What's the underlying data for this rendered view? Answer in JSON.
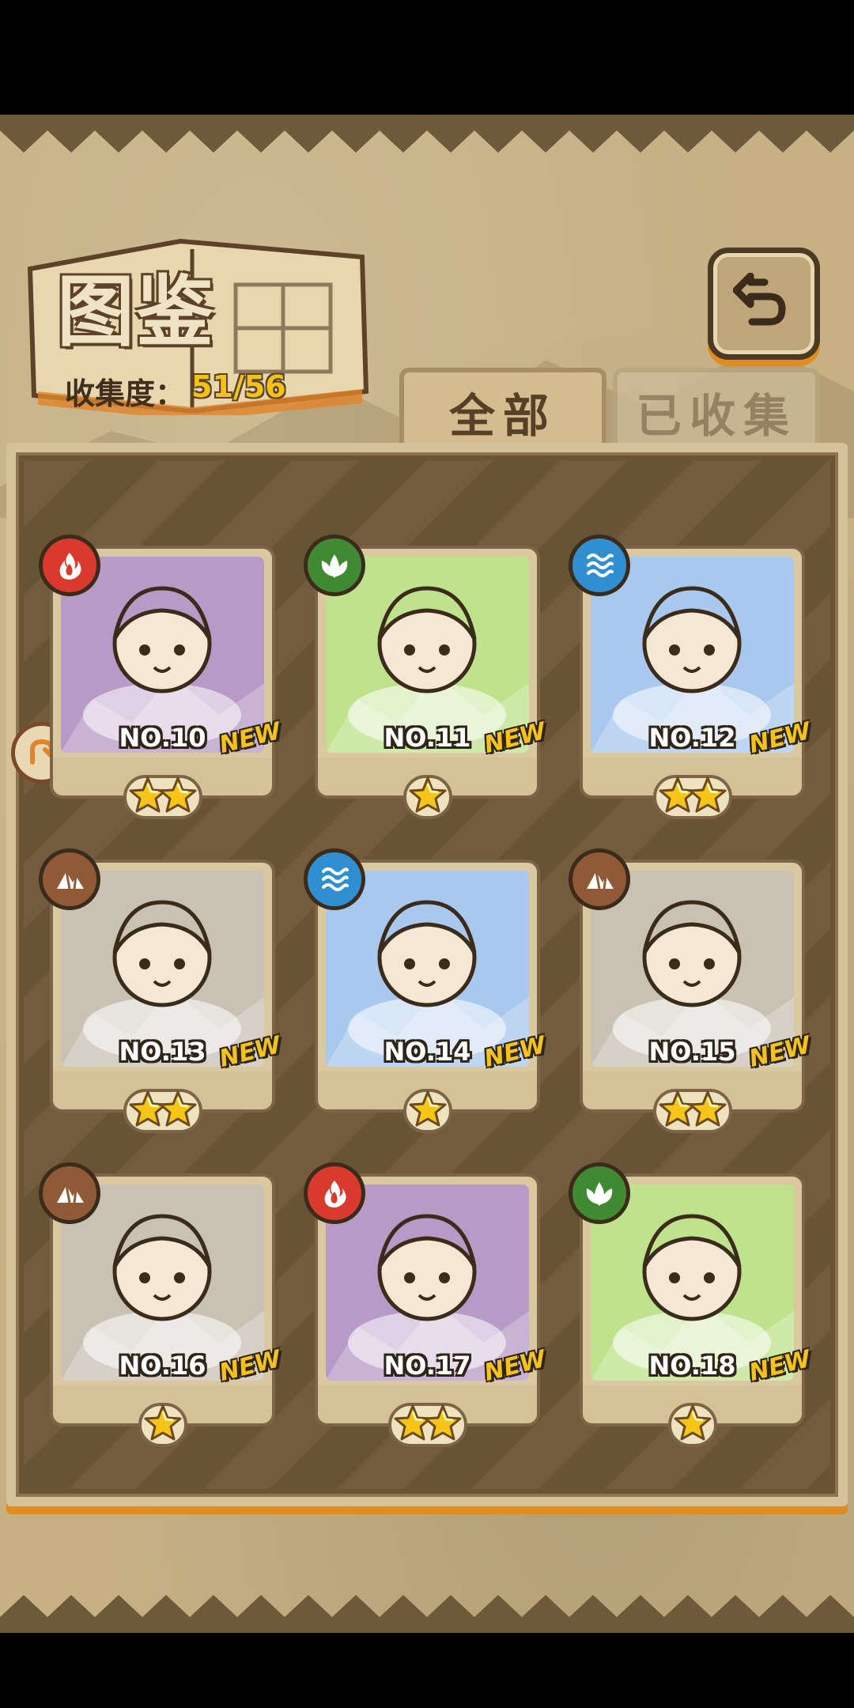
{
  "title": "图鉴",
  "collection": {
    "label": "收集度：",
    "value": "51/56"
  },
  "tabs": {
    "all": "全部",
    "collected": "已收集"
  },
  "colors": {
    "fire": "#d83a2c",
    "leaf": "#3f8a32",
    "water": "#2f8fd0",
    "earth": "#8f5a35",
    "star": "#f5c518",
    "new": "#f3c21c"
  },
  "cards": [
    {
      "number": "NO.10",
      "element": "fire-icon",
      "stars": 2,
      "new_label": "NEW"
    },
    {
      "number": "NO.11",
      "element": "leaf-icon",
      "stars": 1,
      "new_label": "NEW"
    },
    {
      "number": "NO.12",
      "element": "water-icon",
      "stars": 2,
      "new_label": "NEW"
    },
    {
      "number": "NO.13",
      "element": "earth-icon",
      "stars": 2,
      "new_label": "NEW"
    },
    {
      "number": "NO.14",
      "element": "water-icon",
      "stars": 1,
      "new_label": "NEW"
    },
    {
      "number": "NO.15",
      "element": "earth-icon",
      "stars": 2,
      "new_label": "NEW"
    },
    {
      "number": "NO.16",
      "element": "earth-icon",
      "stars": 1,
      "new_label": "NEW"
    },
    {
      "number": "NO.17",
      "element": "fire-icon",
      "stars": 2,
      "new_label": "NEW"
    },
    {
      "number": "NO.18",
      "element": "leaf-icon",
      "stars": 1,
      "new_label": "NEW"
    }
  ]
}
